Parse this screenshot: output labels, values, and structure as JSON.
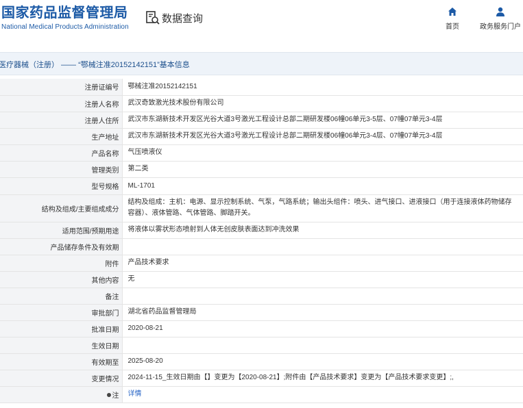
{
  "header": {
    "brand_cn": "国家药品监督管理局",
    "brand_en": "National Medical Products Administration",
    "query_label": "数据查询",
    "nav": {
      "home": "首页",
      "service": "政务服务门户"
    }
  },
  "titlebar": {
    "text": "医疗器械（注册） —— “鄂械注准20152142151”基本信息"
  },
  "rows": [
    {
      "label": "注册证编号",
      "value": "鄂械注准20152142151"
    },
    {
      "label": "注册人名称",
      "value": "武汉奇致激光技术股份有限公司"
    },
    {
      "label": "注册人住所",
      "value": "武汉市东湖新技术开发区光谷大道3号激光工程设计总部二期研发楼06幢06单元3-5层、07幢07单元3-4层"
    },
    {
      "label": "生产地址",
      "value": "武汉市东湖新技术开发区光谷大道3号激光工程设计总部二期研发楼06幢06单元3-4层、07幢07单元3-4层"
    },
    {
      "label": "产品名称",
      "value": "气压喷液仪"
    },
    {
      "label": "管理类别",
      "value": "第二类"
    },
    {
      "label": "型号规格",
      "value": "ML-1701"
    },
    {
      "label": "结构及组成/主要组成成分",
      "value": "结构及组成：主机：电源、显示控制系统、气泵，气路系统；输出头组件：喷头、进气接口、进液接口（用于连接液体药物储存容器）、液体管路、气体管路、脚踏开关。"
    },
    {
      "label": "适用范围/预期用途",
      "value": "将液体以雾状形态喷射到人体无创皮肤表面达到冲洗效果"
    },
    {
      "label": "产品储存条件及有效期",
      "value": ""
    },
    {
      "label": "附件",
      "value": "产品技术要求"
    },
    {
      "label": "其他内容",
      "value": "无"
    },
    {
      "label": "备注",
      "value": ""
    },
    {
      "label": "审批部门",
      "value": "湖北省药品监督管理局"
    },
    {
      "label": "批准日期",
      "value": "2020-08-21"
    },
    {
      "label": "生效日期",
      "value": ""
    },
    {
      "label": "有效期至",
      "value": "2025-08-20"
    },
    {
      "label": "变更情况",
      "value": "2024-11-15_生效日期由【】变更为【2020-08-21】;附件由【产品技术要求】变更为【产品技术要求变更】;,"
    },
    {
      "label": "注",
      "value": "详情",
      "link": true
    }
  ],
  "icons": {
    "query": "document-search-icon",
    "home": "home-icon",
    "service": "user-icon",
    "note": "dot-icon"
  },
  "colors": {
    "brand": "#1c5aa6",
    "link": "#2563c5",
    "label_bg": "#f3f4f6",
    "titlebar_bg": "#eef3f9"
  }
}
